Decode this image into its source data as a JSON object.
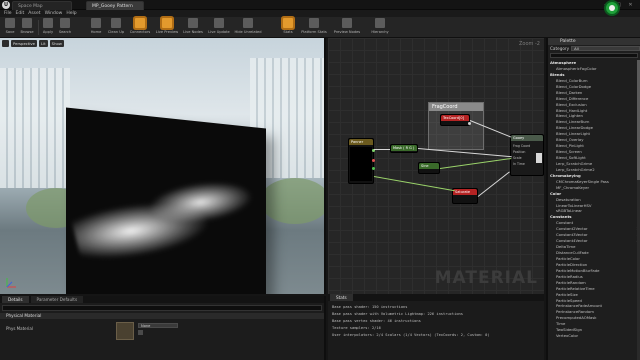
{
  "titlebar": {
    "tabs": [
      "Space Map",
      "MP_Gooey Pattern"
    ],
    "min_glyph": "—",
    "max_glyph": "□",
    "close_glyph": "✕"
  },
  "menu": [
    "File",
    "Edit",
    "Asset",
    "Window",
    "Help"
  ],
  "toolbar": {
    "buttons": [
      "Save",
      "Browse",
      "Apply",
      "Search",
      "Home",
      "Clean Up",
      "Connectors",
      "Live Preview",
      "Live Nodes",
      "Live Update",
      "Hide Unrelated",
      "Stats",
      "Platform Stats",
      "Preview Nodes",
      "Hierarchy"
    ],
    "active": [
      "Connectors",
      "Live Preview",
      "Stats"
    ],
    "accent": "#e39a2d"
  },
  "viewport": {
    "chips": [
      "Perspective",
      "Lit",
      "Show"
    ]
  },
  "graph": {
    "zoom": "Zoom -2",
    "watermark": "MATERIAL",
    "comment": "FragCoord",
    "nodes": {
      "texcoord": "TexCoord[0]",
      "panner": "Panner",
      "mask": "Mask ( R G )",
      "sin": "Sine",
      "saturate": "Saturate",
      "result": "Gooey"
    },
    "result_pins": [
      "Frag Coord",
      "Position",
      "Scale",
      "In Time"
    ]
  },
  "palette": {
    "title": "Palette",
    "category_label": "Category",
    "category_value": "All",
    "rows": [
      {
        "t": "Atmosphere",
        "h": true
      },
      {
        "t": "AtmosphericFogColor"
      },
      {
        "t": "Blends",
        "h": true
      },
      {
        "t": "Blend_ColorBurn"
      },
      {
        "t": "Blend_ColorDodge"
      },
      {
        "t": "Blend_Darken"
      },
      {
        "t": "Blend_Difference"
      },
      {
        "t": "Blend_Exclusion"
      },
      {
        "t": "Blend_HardLight"
      },
      {
        "t": "Blend_Lighten"
      },
      {
        "t": "Blend_LinearBurn"
      },
      {
        "t": "Blend_LinearDodge"
      },
      {
        "t": "Blend_LinearLight"
      },
      {
        "t": "Blend_Overlay"
      },
      {
        "t": "Blend_PinLight"
      },
      {
        "t": "Blend_Screen"
      },
      {
        "t": "Blend_SoftLight"
      },
      {
        "t": "Lerp_ScratchGrime"
      },
      {
        "t": "Lerp_ScratchGrime2"
      },
      {
        "t": "Chromakeying",
        "h": true
      },
      {
        "t": "CMChromaKeyerSingle Pass"
      },
      {
        "t": "MF_ChromaKeyer"
      },
      {
        "t": "Color",
        "h": true
      },
      {
        "t": "Desaturation"
      },
      {
        "t": "LinearToLinearHSV"
      },
      {
        "t": "sRGBToLinear"
      },
      {
        "t": "Constants",
        "h": true
      },
      {
        "t": "Constant",
        "n": "1"
      },
      {
        "t": "Constant2Vector",
        "n": "2"
      },
      {
        "t": "Constant3Vector",
        "n": "3"
      },
      {
        "t": "Constant4Vector",
        "n": "4"
      },
      {
        "t": "DeltaTime"
      },
      {
        "t": "DistanceCullFade"
      },
      {
        "t": "ParticleColor"
      },
      {
        "t": "ParticleDirection"
      },
      {
        "t": "ParticleMotionBlurFade"
      },
      {
        "t": "ParticleRadius"
      },
      {
        "t": "ParticleRandom"
      },
      {
        "t": "ParticleRelativeTime"
      },
      {
        "t": "ParticleSize"
      },
      {
        "t": "ParticleSpeed"
      },
      {
        "t": "PerInstanceFadeAmount"
      },
      {
        "t": "PerInstanceRandom"
      },
      {
        "t": "PrecomputedAOMask"
      },
      {
        "t": "Time"
      },
      {
        "t": "TwoSidedSign"
      },
      {
        "t": "VertexColor"
      }
    ]
  },
  "details": {
    "tabs": [
      "Details",
      "Parameter Defaults"
    ],
    "category": "Physical Material",
    "row_label": "Phys Material",
    "combo_value": "None"
  },
  "stats": {
    "title": "Stats",
    "lines": [
      "Base pass shader: 150 instructions",
      "Base pass shader with Volumetric Lightmap: 226 instructions",
      "Base pass vertex shader: 46 instructions",
      "Texture samplers: 2/16",
      "User interpolators: 2/4 Scalars (1/4 Vectors) (TexCoords: 2, Custom: 0)"
    ]
  }
}
